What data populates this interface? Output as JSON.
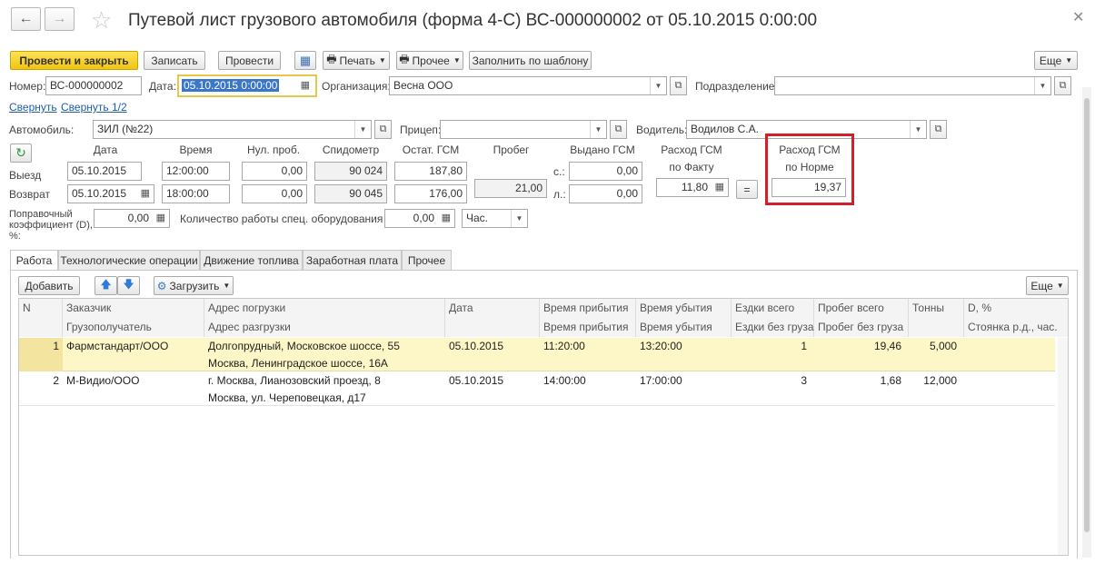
{
  "window": {
    "title": "Путевой лист грузового автомобиля (форма 4-С) ВС-000000002 от 05.10.2015 0:00:00"
  },
  "toolbar": {
    "post_close": "Провести и закрыть",
    "save": "Записать",
    "post": "Провести",
    "print": "Печать",
    "other": "Прочее",
    "fill_template": "Заполнить по шаблону",
    "more": "Еще"
  },
  "header": {
    "number_label": "Номер:",
    "number": "ВС-000000002",
    "date_label": "Дата:",
    "date": "05.10.2015  0:00:00",
    "org_label": "Организация:",
    "org": "Весна ООО",
    "dept_label": "Подразделение:",
    "dept": "",
    "collapse": "Свернуть",
    "collapse_half": "Свернуть 1/2",
    "car_label": "Автомобиль:",
    "car": "ЗИЛ (№22)",
    "trailer_label": "Прицеп:",
    "trailer": "",
    "driver_label": "Водитель:",
    "driver": "Водилов С.А."
  },
  "trip": {
    "col_date": "Дата",
    "col_time": "Время",
    "col_zero": "Нул. проб.",
    "col_speedo": "Спидометр",
    "col_fuel_left": "Остат. ГСМ",
    "col_mileage": "Пробег",
    "col_fuel_issued": "Выдано ГСМ",
    "fact_l1": "Расход ГСМ",
    "fact_l2": "по Факту",
    "norm_l1": "Расход ГСМ",
    "norm_l2": "по Норме",
    "out_label": "Выезд",
    "ret_label": "Возврат",
    "out_date": "05.10.2015",
    "out_time": "12:00:00",
    "out_zero": "0,00",
    "out_speedo": "90 024",
    "out_fuel": "187,80",
    "ret_date": "05.10.2015",
    "ret_time": "18:00:00",
    "ret_zero": "0,00",
    "ret_speedo": "90 045",
    "ret_fuel": "176,00",
    "mileage": "21,00",
    "s_label": "с.:",
    "l_label": "л.:",
    "issued_s": "0,00",
    "issued_l": "0,00",
    "fact": "11,80",
    "eq": "=",
    "norm": "19,37",
    "coef_label_1": "Поправочный",
    "coef_label_2": "коэффициент (D),",
    "coef_label_3": "%:",
    "coef": "0,00",
    "equip_label": "Количество работы спец. оборудования (Т):",
    "equip": "0,00",
    "equip_unit": "Час."
  },
  "tabs": [
    "Работа",
    "Технологические операции",
    "Движение топлива",
    "Заработная плата",
    "Прочее"
  ],
  "table_toolbar": {
    "add": "Добавить",
    "load": "Загрузить",
    "more": "Еще"
  },
  "table": {
    "header1": [
      "N",
      "Заказчик",
      "Адрес погрузки",
      "Дата",
      "Время прибытия",
      "Время убытия",
      "Ездки всего",
      "Пробег всего",
      "Тонны",
      "D, %"
    ],
    "header2": [
      "",
      "Грузополучатель",
      "Адрес разгрузки",
      "",
      "Время прибытия",
      "Время убытия",
      "Ездки без груза",
      "Пробег без груза",
      "",
      "Стоянка р.д., час."
    ],
    "rows": [
      {
        "n": "1",
        "customer": "Фармстандарт/ООО",
        "load": "Долгопрудный, Московское шоссе, 55",
        "unload": "Москва, Ленинградское шоссе, 16А",
        "date": "05.10.2015",
        "arr": "11:20:00",
        "dep": "13:20:00",
        "trips": "1",
        "mileage": "19,46",
        "tons": "5,000"
      },
      {
        "n": "2",
        "customer": "М-Видио/ООО",
        "load": "г. Москва, Лианозовский проезд, 8",
        "unload": "Москва, ул. Череповецкая, д17",
        "date": "05.10.2015",
        "arr": "14:00:00",
        "dep": "17:00:00",
        "trips": "3",
        "mileage": "1,68",
        "tons": "12,000"
      }
    ]
  },
  "colors": {
    "accent_yellow": "#f1c40f",
    "highlight_red": "#d0202a",
    "selected_row": "#fdf6c7"
  }
}
